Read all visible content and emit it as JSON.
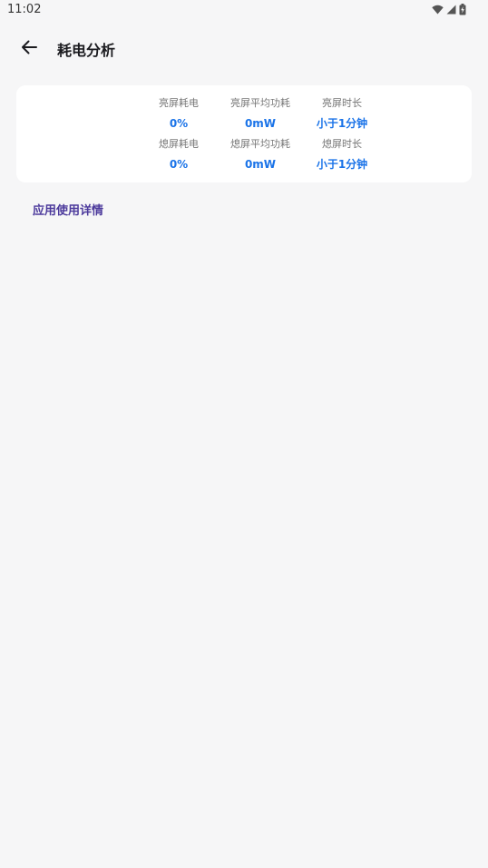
{
  "status_bar": {
    "time": "11:02",
    "icons": [
      "wifi-icon",
      "cell-signal-icon",
      "battery-charging-icon"
    ]
  },
  "app_bar": {
    "back_icon": "arrow-left-icon",
    "title": "耗电分析"
  },
  "stats": {
    "screen_on": {
      "consumption_label": "亮屏耗电",
      "consumption_value": "0%",
      "avg_power_label": "亮屏平均功耗",
      "avg_power_value": "0mW",
      "duration_label": "亮屏时长",
      "duration_value": "小于1分钟"
    },
    "screen_off": {
      "consumption_label": "熄屏耗电",
      "consumption_value": "0%",
      "avg_power_label": "熄屏平均功耗",
      "avg_power_value": "0mW",
      "duration_label": "熄屏时长",
      "duration_value": "小于1分钟"
    }
  },
  "section": {
    "app_usage_details": "应用使用详情"
  },
  "colors": {
    "background": "#f6f6f7",
    "value_blue": "#1a73e8",
    "link_purple": "#4c3a9c"
  }
}
